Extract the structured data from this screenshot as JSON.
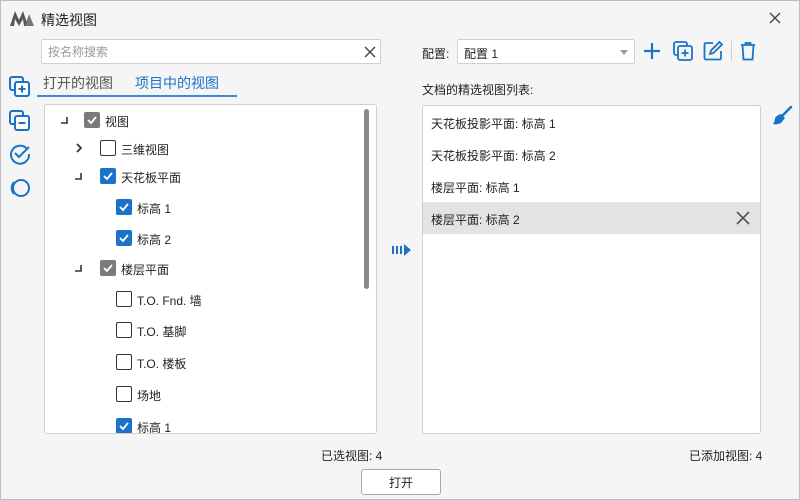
{
  "window": {
    "title": "精选视图"
  },
  "search": {
    "placeholder": "按名称搜索",
    "value": ""
  },
  "tabs": [
    {
      "label": "打开的视图",
      "active": false
    },
    {
      "label": "项目中的视图",
      "active": true
    }
  ],
  "tree": [
    {
      "label": "视图",
      "state": "partial",
      "expander": "collapse"
    },
    {
      "label": "三维视图",
      "state": "unchecked",
      "expander": "expand"
    },
    {
      "label": "天花板平面",
      "state": "checked",
      "expander": "collapse"
    },
    {
      "label": "标高 1",
      "state": "checked"
    },
    {
      "label": "标高 2",
      "state": "checked"
    },
    {
      "label": "楼层平面",
      "state": "partial",
      "expander": "collapse"
    },
    {
      "label": "T.O. Fnd. 墙",
      "state": "unchecked"
    },
    {
      "label": "T.O. 基脚",
      "state": "unchecked"
    },
    {
      "label": "T.O. 楼板",
      "state": "unchecked"
    },
    {
      "label": "场地",
      "state": "unchecked"
    },
    {
      "label": "标高 1",
      "state": "checked"
    }
  ],
  "config": {
    "label": "配置:",
    "selected": "配置 1"
  },
  "list": {
    "label": "文档的精选视图列表:",
    "items": [
      "天花板投影平面: 标高 1",
      "天花板投影平面: 标高 2",
      "楼层平面: 标高 1",
      "楼层平面: 标高 2"
    ],
    "selected_index": 3
  },
  "footer": {
    "selected_count": "已选视图: 4",
    "added_count": "已添加视图: 4",
    "open_label": "打开"
  },
  "colors": {
    "accent": "#1a73c8",
    "partial": "#7a7a7a",
    "selected_row": "#e3e3e3"
  },
  "icons": {
    "app": "app-logo-icon",
    "close": "close-icon",
    "left_tools": [
      "add-views-icon",
      "remove-views-icon",
      "check-all-icon",
      "uncheck-all-icon"
    ],
    "config_tools": [
      "add-icon",
      "duplicate-icon",
      "edit-icon",
      "delete-icon"
    ],
    "move": "move-right-icon",
    "clear": "brush-icon"
  }
}
